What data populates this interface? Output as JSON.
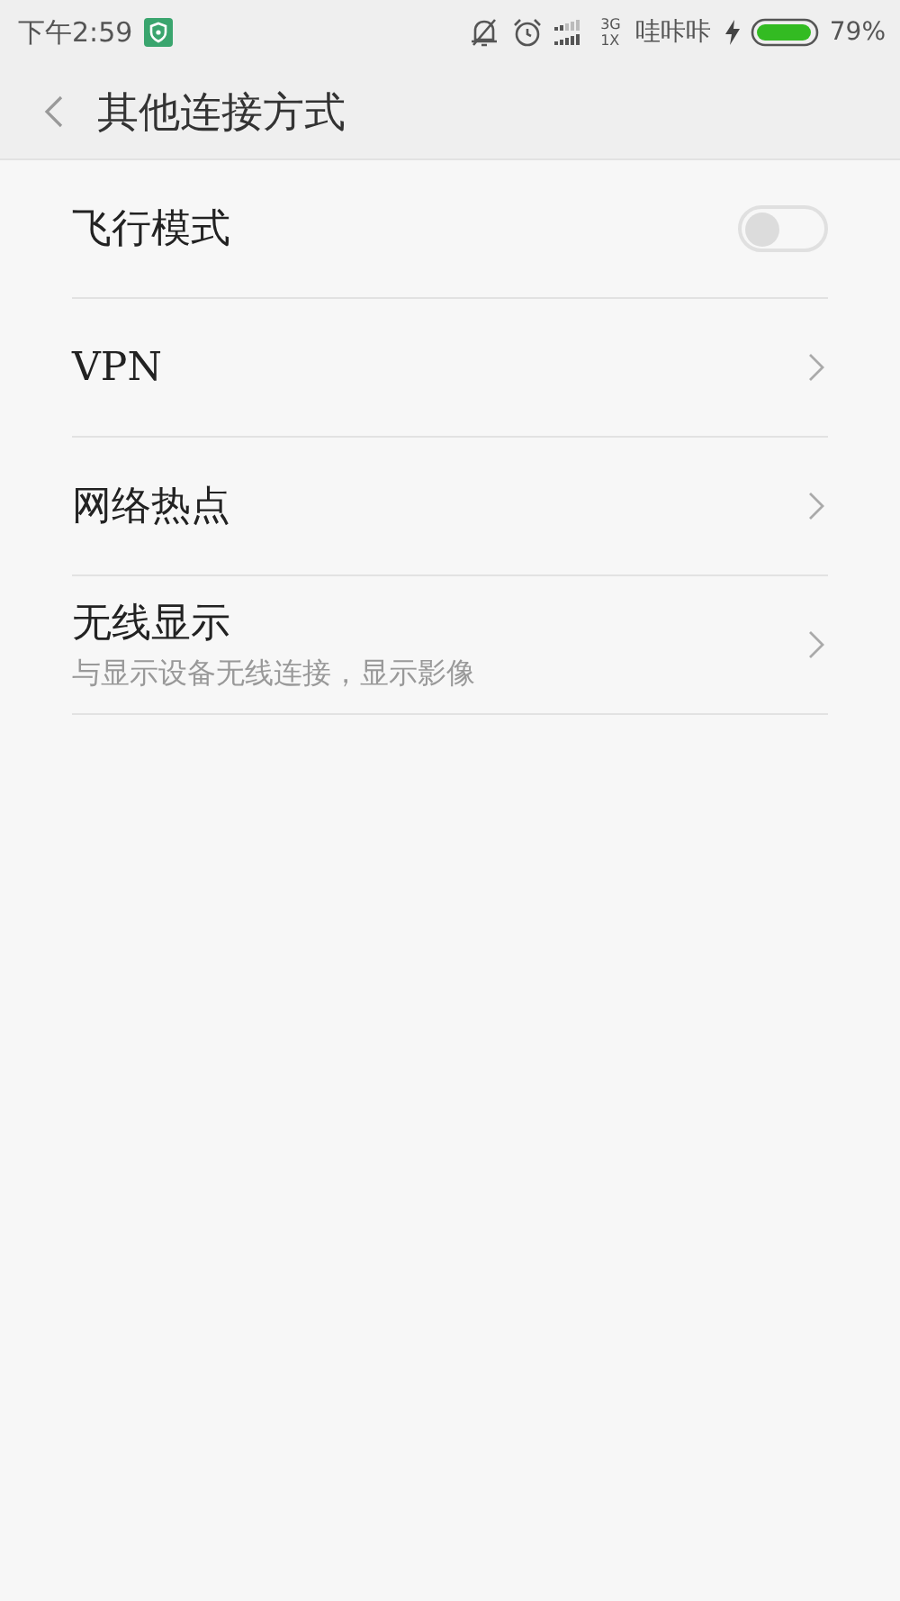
{
  "status_bar": {
    "time": "下午2:59",
    "network_top": "3G",
    "network_bottom": "1X",
    "carrier": "哇咔咔",
    "battery": "79%"
  },
  "header": {
    "title": "其他连接方式"
  },
  "items": [
    {
      "kind": "toggle",
      "label": "飞行模式",
      "on": false
    },
    {
      "kind": "link",
      "label": "VPN"
    },
    {
      "kind": "link",
      "label": "网络热点"
    },
    {
      "kind": "link",
      "label": "无线显示",
      "subtitle": "与显示设备无线连接，显示影像"
    }
  ]
}
